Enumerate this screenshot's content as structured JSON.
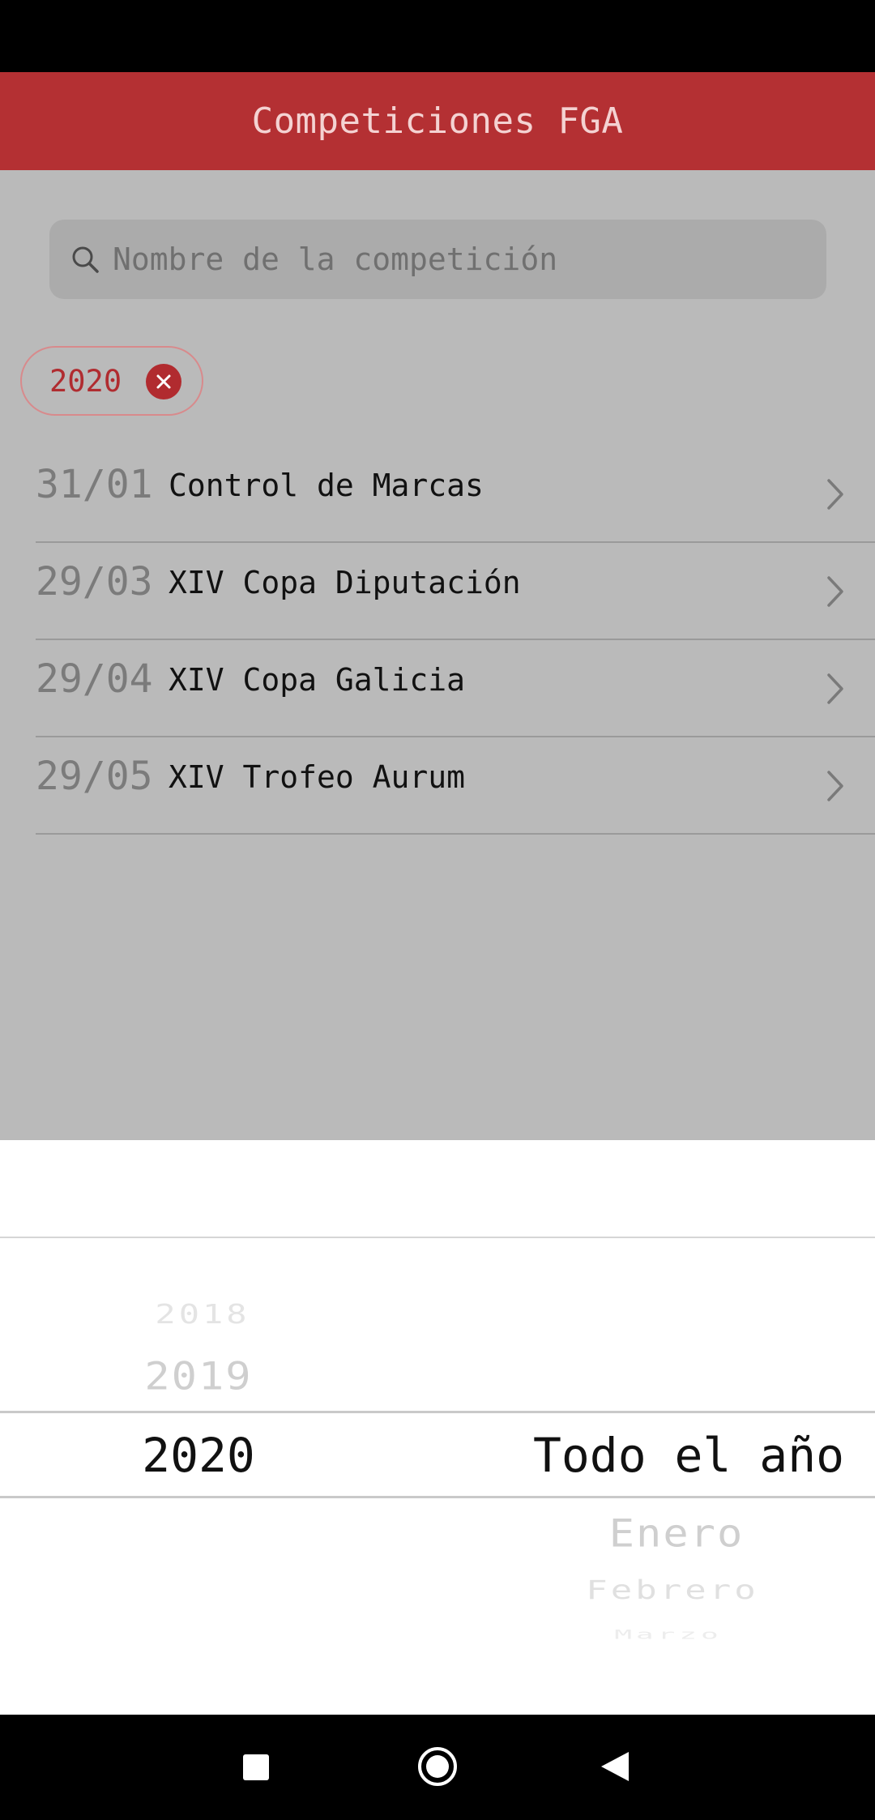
{
  "header": {
    "title": "Competiciones FGA"
  },
  "search": {
    "placeholder": "Nombre de la competición",
    "value": ""
  },
  "filter_chip": {
    "label": "2020"
  },
  "competitions": [
    {
      "date": "31/01",
      "name": "Control de Marcas"
    },
    {
      "date": "29/03",
      "name": "XIV Copa Diputación"
    },
    {
      "date": "29/04",
      "name": "XIV Copa Galicia"
    },
    {
      "date": "29/05",
      "name": "XIV Trofeo Aurum"
    }
  ],
  "picker": {
    "year_column": {
      "above": [
        "2018",
        "2019"
      ],
      "selected": "2020",
      "below": []
    },
    "month_column": {
      "above": [],
      "selected": "Todo el año",
      "below": [
        "Enero",
        "Febrero",
        "Marzo"
      ]
    }
  },
  "colors": {
    "accent": "#b43033",
    "chip_text": "#b02c30",
    "overlay_bg": "#bababa"
  },
  "icons": {
    "search": "search-icon",
    "chip_close": "close-icon",
    "row": "chevron-right-icon",
    "nav_recent": "square-icon",
    "nav_home": "circle-icon",
    "nav_back": "triangle-back-icon"
  }
}
